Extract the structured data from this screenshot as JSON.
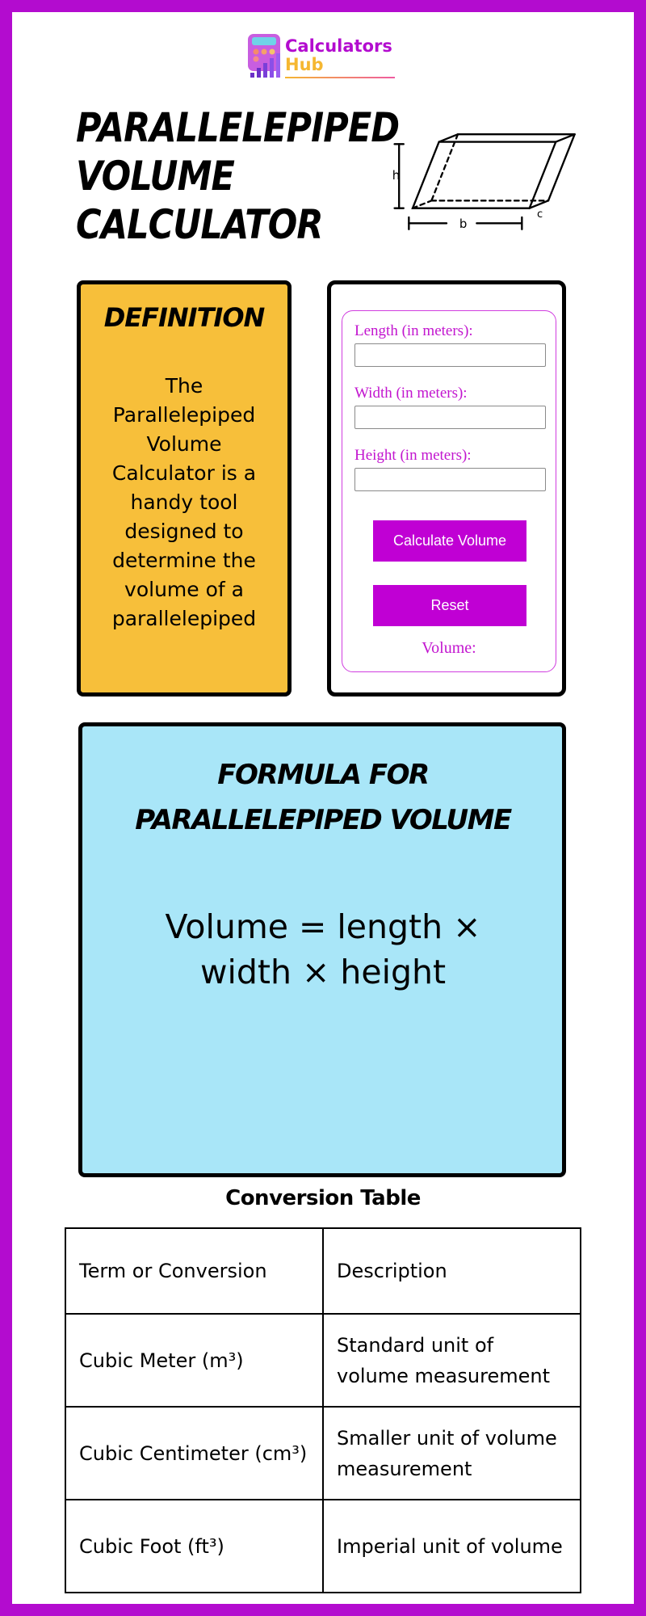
{
  "brand": {
    "line1": "Calculators",
    "line2": "Hub",
    "primary_color": "#b30ccf",
    "secondary_color": "#f5b731"
  },
  "page_title": "Parallelepiped Volume Calculator",
  "diagram": {
    "icon": "parallelepiped-diagram",
    "labels": {
      "height": "h",
      "base": "b",
      "depth": "c"
    }
  },
  "definition": {
    "heading": "DEFINITION",
    "body": "The Parallelepiped Volume Calculator is a handy tool designed to determine the volume of a parallelepiped",
    "background": "#f7bf3a"
  },
  "calculator": {
    "fields": [
      {
        "label": "Length (in meters):",
        "value": "",
        "placeholder": ""
      },
      {
        "label": "Width (in meters):",
        "value": "",
        "placeholder": ""
      },
      {
        "label": "Height (in meters):",
        "value": "",
        "placeholder": ""
      }
    ],
    "calculate_label": "Calculate Volume",
    "reset_label": "Reset",
    "result_label": "Volume:",
    "accent": "#c000d4"
  },
  "formula": {
    "heading": "FORMULA FOR PARALLELEPIPED VOLUME",
    "expression": "Volume = length × width × height",
    "background": "#a9e6f8"
  },
  "conversion_table": {
    "title": "Conversion Table",
    "headers": [
      "Term or Conversion",
      "Description"
    ],
    "rows": [
      [
        "Cubic Meter (m³)",
        "Standard unit of volume measurement"
      ],
      [
        "Cubic Centimeter (cm³)",
        "Smaller unit of volume measurement"
      ],
      [
        "Cubic Foot (ft³)",
        "Imperial unit of volume"
      ]
    ]
  }
}
